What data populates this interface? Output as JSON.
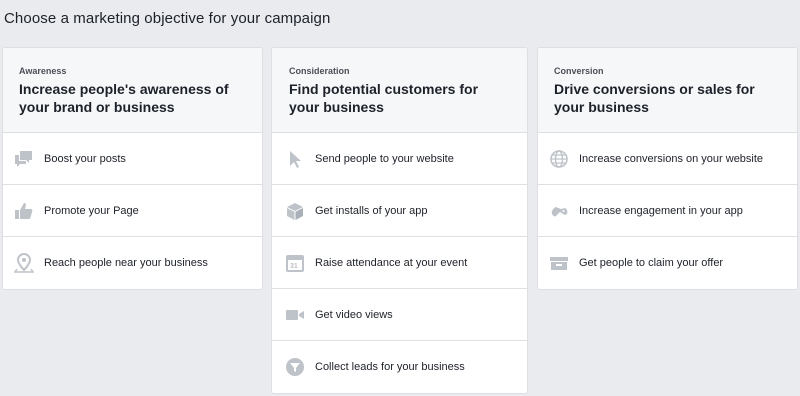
{
  "page": {
    "title": "Choose a marketing objective for your campaign"
  },
  "colors": {
    "icon": "#bec3c9",
    "background": "#e9ebee",
    "header_bg": "#f6f7f9",
    "border": "#dddfe2"
  },
  "columns": [
    {
      "eyebrow": "Awareness",
      "title": "Increase people's awareness of your brand or business",
      "items": [
        {
          "label": "Boost your posts",
          "icon": "speech-bubble-icon"
        },
        {
          "label": "Promote your Page",
          "icon": "thumbs-up-icon"
        },
        {
          "label": "Reach people near your business",
          "icon": "map-pin-icon"
        }
      ]
    },
    {
      "eyebrow": "Consideration",
      "title": "Find potential customers for your business",
      "items": [
        {
          "label": "Send people to your website",
          "icon": "cursor-icon"
        },
        {
          "label": "Get installs of your app",
          "icon": "box-icon"
        },
        {
          "label": "Raise attendance at your event",
          "icon": "calendar-icon"
        },
        {
          "label": "Get video views",
          "icon": "video-camera-icon"
        },
        {
          "label": "Collect leads for your business",
          "icon": "funnel-icon"
        }
      ]
    },
    {
      "eyebrow": "Conversion",
      "title": "Drive conversions or sales for your business",
      "items": [
        {
          "label": "Increase conversions on your website",
          "icon": "globe-icon"
        },
        {
          "label": "Increase engagement in your app",
          "icon": "gamepad-icon"
        },
        {
          "label": "Get people to claim your offer",
          "icon": "offer-tag-icon"
        }
      ]
    }
  ]
}
